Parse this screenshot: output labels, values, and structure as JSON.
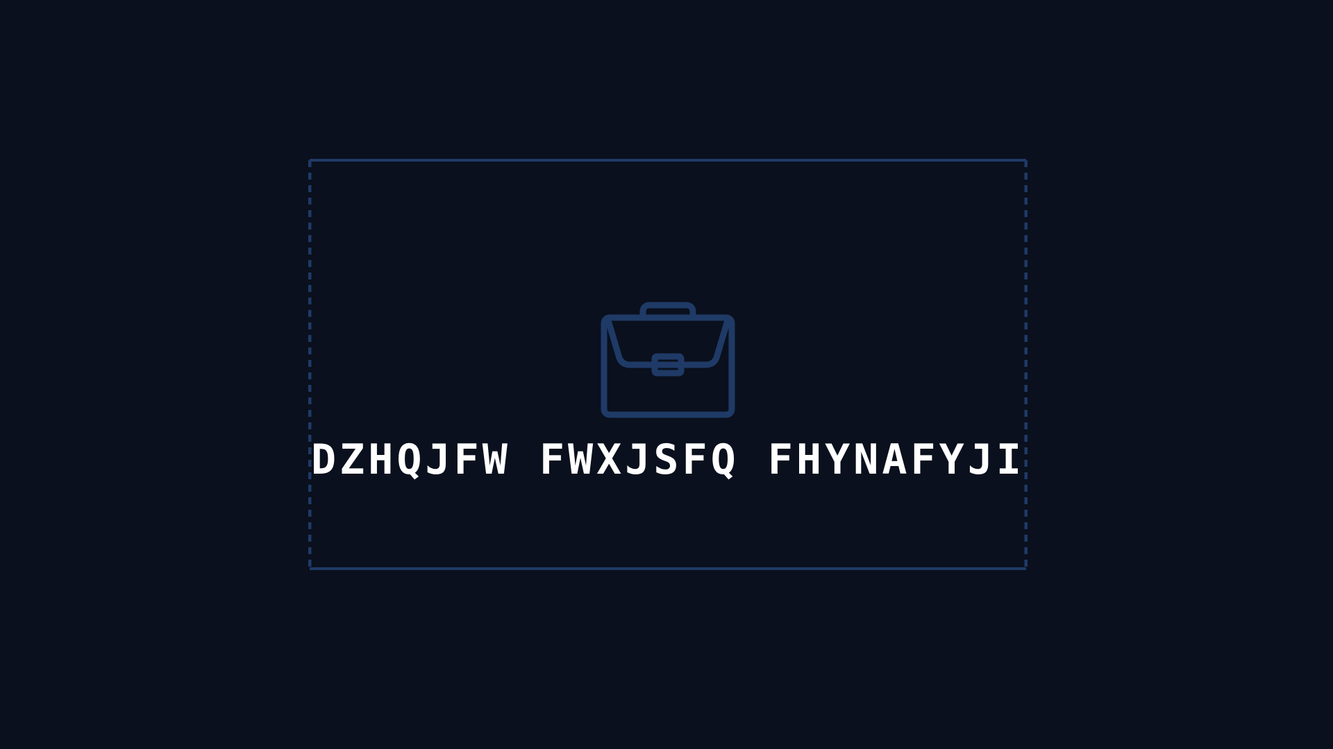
{
  "splash": {
    "icon": "briefcase-icon",
    "title": "DZHQJFW FWXJSFQ FHYNAFYJI"
  },
  "colors": {
    "background": "#0a101d",
    "accent": "#1f3a66",
    "text": "#ffffff"
  }
}
